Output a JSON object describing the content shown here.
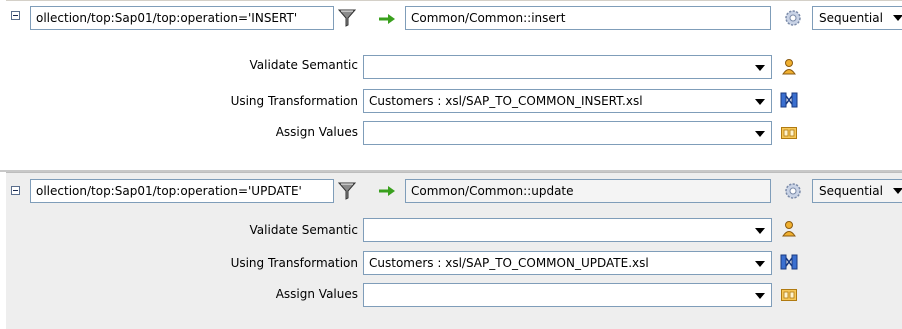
{
  "routing_rules": [
    {
      "xpath": "ollection/top:Sap01/top:operation='INSERT'",
      "operation": "Common/Common::insert",
      "execution": "Sequential",
      "validate_semantic_label": "Validate Semantic",
      "validate_semantic_value": "",
      "transformation_label": "Using Transformation",
      "transformation_value": "Customers : xsl/SAP_TO_COMMON_INSERT.xsl",
      "assign_values_label": "Assign Values",
      "assign_values_value": ""
    },
    {
      "xpath": "ollection/top:Sap01/top:operation='UPDATE'",
      "operation": "Common/Common::update",
      "execution": "Sequential",
      "validate_semantic_label": "Validate Semantic",
      "validate_semantic_value": "",
      "transformation_label": "Using Transformation",
      "transformation_value": "Customers : xsl/SAP_TO_COMMON_UPDATE.xsl",
      "assign_values_label": "Assign Values",
      "assign_values_value": ""
    }
  ],
  "icons": {
    "collapse": "collapse-icon",
    "filter": "filter-icon",
    "arrow": "arrow-right-icon",
    "operation_settings": "gear-icon",
    "validate": "schematron-icon",
    "transformation": "mapper-icon",
    "assign": "assign-icon"
  },
  "colors": {
    "arrow_green": "#3aa01e",
    "field_border": "#7f9db9",
    "panel_alt_bg": "#eeeeee"
  }
}
